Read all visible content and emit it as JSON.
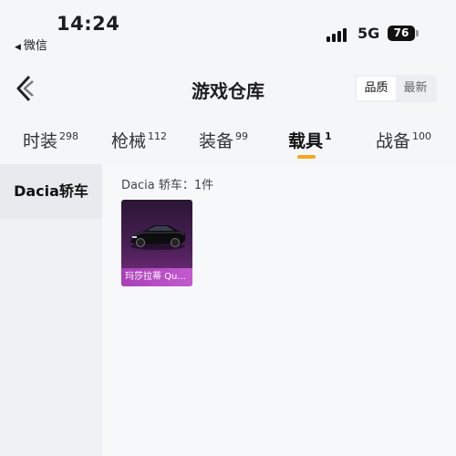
{
  "status": {
    "time": "14:24",
    "back_app": "微信",
    "network": "5G",
    "battery": "76",
    "icons": [
      "back-triangle-icon",
      "signal-icon",
      "battery-icon"
    ]
  },
  "header": {
    "back_icon": "chevron-left-icon",
    "title": "游戏仓库",
    "sort_options": [
      "品质",
      "最新"
    ],
    "active_sort": "品质"
  },
  "tabs": [
    {
      "label": "时装",
      "count": "298"
    },
    {
      "label": "枪械",
      "count": "112"
    },
    {
      "label": "装备",
      "count": "99"
    },
    {
      "label": "载具",
      "count": "1"
    },
    {
      "label": "战备",
      "count": "100"
    }
  ],
  "active_tab": "载具",
  "sidebar": {
    "items": [
      {
        "label": "Dacia轿车"
      }
    ]
  },
  "content": {
    "category_title": "Dacia 轿车：1件",
    "items": [
      {
        "name": "玛莎拉蒂 Qu..."
      }
    ]
  },
  "colors": {
    "accent": "#f5a623",
    "card_purple": "#c35ad0"
  }
}
